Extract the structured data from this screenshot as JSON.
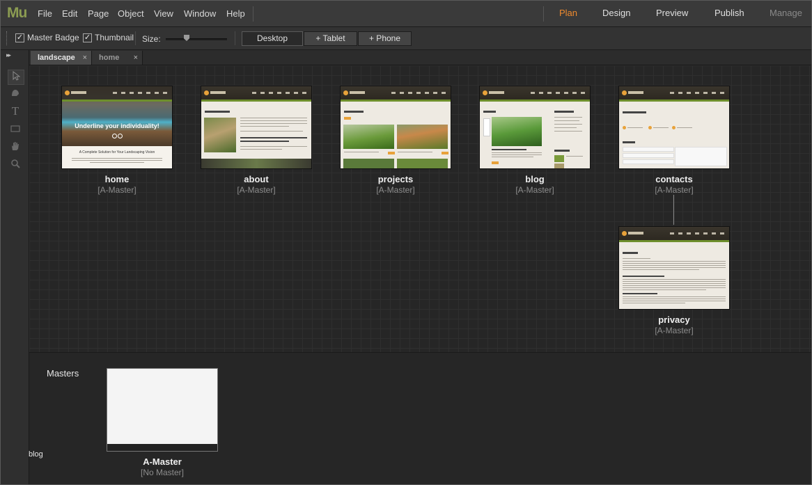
{
  "app": {
    "logo": "Mu"
  },
  "menu": [
    "File",
    "Edit",
    "Page",
    "Object",
    "View",
    "Window",
    "Help"
  ],
  "modes": {
    "plan": "Plan",
    "design": "Design",
    "preview": "Preview",
    "publish": "Publish",
    "manage": "Manage",
    "active": "Plan"
  },
  "toolbar": {
    "master_badge": {
      "label": "Master Badge",
      "checked": true
    },
    "thumbnail": {
      "label": "Thumbnail",
      "checked": true
    },
    "size_label": "Size:",
    "devices": [
      "Desktop",
      "+ Tablet",
      "+ Phone"
    ],
    "active_device": "Desktop"
  },
  "tabs": [
    {
      "label": "landscape",
      "active": true,
      "close": "×"
    },
    {
      "label": "home",
      "active": false,
      "close": "×"
    }
  ],
  "pages": [
    {
      "name": "home",
      "master": "[A-Master]"
    },
    {
      "name": "about",
      "master": "[A-Master]"
    },
    {
      "name": "projects",
      "master": "[A-Master]"
    },
    {
      "name": "blog",
      "master": "[A-Master]"
    },
    {
      "name": "contacts",
      "master": "[A-Master]"
    },
    {
      "name": "privacy",
      "master": "[A-Master]"
    }
  ],
  "thumb_text": {
    "home_headline": "Underline your individuality!",
    "home_sub": "A Complete Solution for Your Landscaping Vision"
  },
  "masters": {
    "heading": "Masters",
    "items": [
      {
        "name": "A-Master",
        "master": "[No Master]"
      }
    ]
  },
  "status_label": "blog",
  "icons": [
    "selection-tool-icon",
    "crop-tool-icon",
    "text-tool-icon",
    "rectangle-tool-icon",
    "hand-tool-icon",
    "zoom-tool-icon",
    "checkbox-check-icon",
    "close-tab-icon",
    "collapse-panel-icon"
  ],
  "colors": {
    "accent_active_mode": "#ef8a2e",
    "logo": "#8c9c52",
    "thumb_header_green": "#6e8f2c",
    "thumb_button_orange": "#e8a23a"
  }
}
